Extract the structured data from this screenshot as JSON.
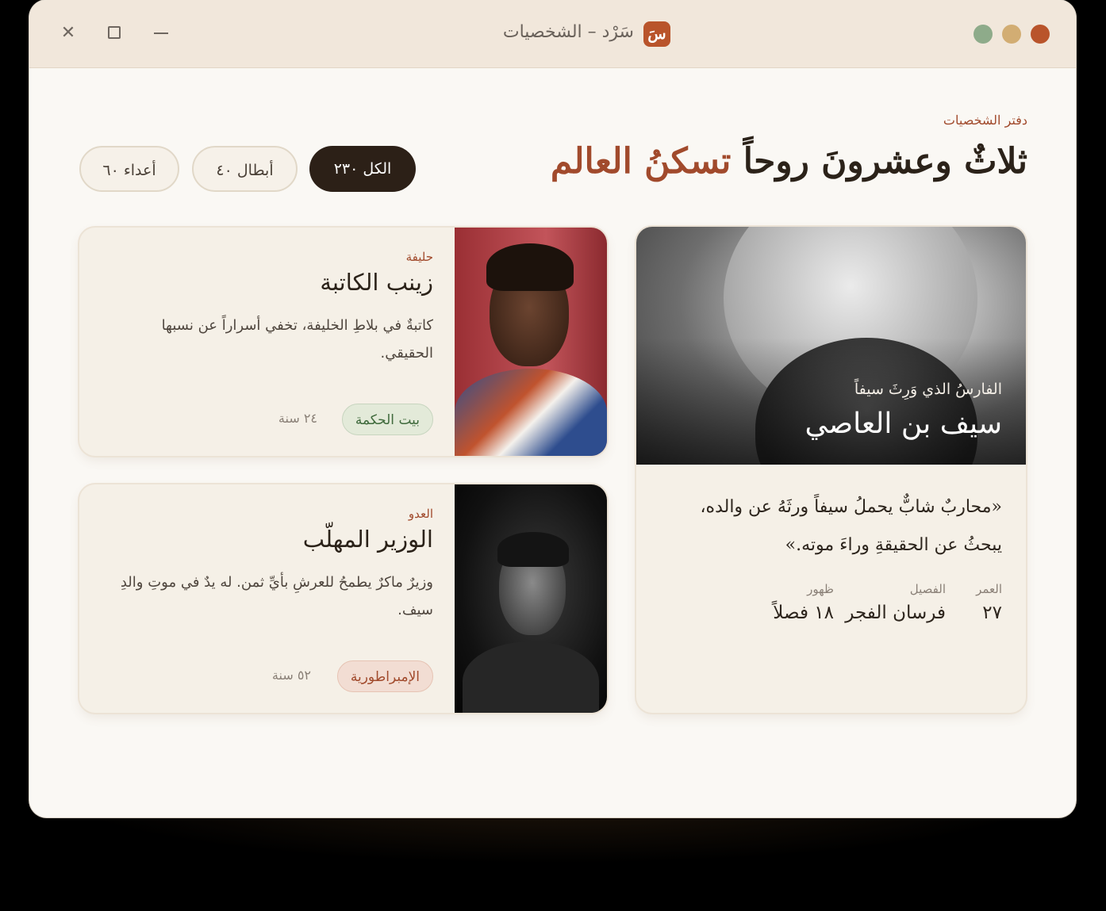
{
  "window": {
    "title": "سَرْد – الشخصيات",
    "logo_letter": "سَ",
    "controls": [
      "close-icon",
      "maximize-icon",
      "minimize-icon"
    ],
    "traffic_lights": [
      "#b9542b",
      "#d2ad73",
      "#8eab8a"
    ]
  },
  "header": {
    "eyebrow": "دفتر الشخصيات",
    "headline_main": "ثلاثٌ وعشرونَ روحاً",
    "headline_accent": "تسكنُ العالم"
  },
  "filters": [
    {
      "label": "الكل ٢٣٠",
      "active": true
    },
    {
      "label": "أبطال ٤٠",
      "active": false
    },
    {
      "label": "أعداء ٦٠",
      "active": false
    }
  ],
  "featured": {
    "subtitle": "الفارسُ الذي وَرِثَ سيفاً",
    "name": "سيف بن العاصي",
    "quote": "«محاربٌ شابٌّ يحملُ سيفاً ورثَهُ عن والده، يبحثُ عن الحقيقةِ وراءَ موته.»",
    "stats": [
      {
        "label": "العمر",
        "value": "٢٧"
      },
      {
        "label": "الفصيل",
        "value": "فرسان الفجر"
      },
      {
        "label": "ظهور",
        "value": "١٨ فصلاً"
      }
    ]
  },
  "characters": [
    {
      "role": "حليفة",
      "name": "زينب الكاتبة",
      "description": "كاتبةٌ في بلاطِ الخليفة، تخفي أسراراً عن نسبها الحقيقي.",
      "faction": "بيت الحكمة",
      "age": "٢٤ سنة"
    },
    {
      "role": "العدو",
      "name": "الوزير المهلّب",
      "description": "وزيرٌ ماكرٌ يطمحُ للعرشِ بأيِّ ثمن. له يدٌ في موتِ والدِ سيف.",
      "faction": "الإمبراطورية",
      "age": "٥٢ سنة"
    }
  ],
  "colors": {
    "accent": "#a14a2c",
    "ink": "#2b2219",
    "titlebar": "#f1e7db",
    "surface": "#faf8f4",
    "card": "#f5f0e7",
    "badge_green": "#3f6a3c"
  }
}
